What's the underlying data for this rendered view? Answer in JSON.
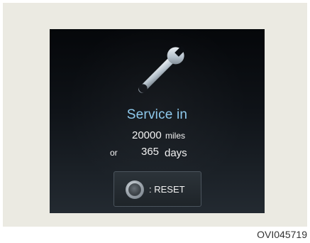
{
  "service": {
    "title": "Service in",
    "distance_value": "20000",
    "distance_unit": "miles",
    "or_label": "or",
    "days_value": "365",
    "days_unit": "days"
  },
  "reset_button": {
    "label": ": RESET"
  },
  "image_code": "OVI045719"
}
